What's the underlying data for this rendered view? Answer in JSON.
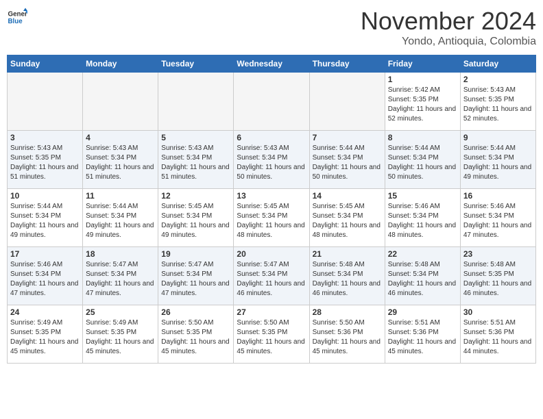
{
  "header": {
    "logo_line1": "General",
    "logo_line2": "Blue",
    "month": "November 2024",
    "location": "Yondo, Antioquia, Colombia"
  },
  "weekdays": [
    "Sunday",
    "Monday",
    "Tuesday",
    "Wednesday",
    "Thursday",
    "Friday",
    "Saturday"
  ],
  "weeks": [
    [
      {
        "day": "",
        "empty": true
      },
      {
        "day": "",
        "empty": true
      },
      {
        "day": "",
        "empty": true
      },
      {
        "day": "",
        "empty": true
      },
      {
        "day": "",
        "empty": true
      },
      {
        "day": "1",
        "sunrise": "5:42 AM",
        "sunset": "5:35 PM",
        "daylight": "11 hours and 52 minutes."
      },
      {
        "day": "2",
        "sunrise": "5:43 AM",
        "sunset": "5:35 PM",
        "daylight": "11 hours and 52 minutes."
      }
    ],
    [
      {
        "day": "3",
        "sunrise": "5:43 AM",
        "sunset": "5:35 PM",
        "daylight": "11 hours and 51 minutes."
      },
      {
        "day": "4",
        "sunrise": "5:43 AM",
        "sunset": "5:34 PM",
        "daylight": "11 hours and 51 minutes."
      },
      {
        "day": "5",
        "sunrise": "5:43 AM",
        "sunset": "5:34 PM",
        "daylight": "11 hours and 51 minutes."
      },
      {
        "day": "6",
        "sunrise": "5:43 AM",
        "sunset": "5:34 PM",
        "daylight": "11 hours and 50 minutes."
      },
      {
        "day": "7",
        "sunrise": "5:44 AM",
        "sunset": "5:34 PM",
        "daylight": "11 hours and 50 minutes."
      },
      {
        "day": "8",
        "sunrise": "5:44 AM",
        "sunset": "5:34 PM",
        "daylight": "11 hours and 50 minutes."
      },
      {
        "day": "9",
        "sunrise": "5:44 AM",
        "sunset": "5:34 PM",
        "daylight": "11 hours and 49 minutes."
      }
    ],
    [
      {
        "day": "10",
        "sunrise": "5:44 AM",
        "sunset": "5:34 PM",
        "daylight": "11 hours and 49 minutes."
      },
      {
        "day": "11",
        "sunrise": "5:44 AM",
        "sunset": "5:34 PM",
        "daylight": "11 hours and 49 minutes."
      },
      {
        "day": "12",
        "sunrise": "5:45 AM",
        "sunset": "5:34 PM",
        "daylight": "11 hours and 49 minutes."
      },
      {
        "day": "13",
        "sunrise": "5:45 AM",
        "sunset": "5:34 PM",
        "daylight": "11 hours and 48 minutes."
      },
      {
        "day": "14",
        "sunrise": "5:45 AM",
        "sunset": "5:34 PM",
        "daylight": "11 hours and 48 minutes."
      },
      {
        "day": "15",
        "sunrise": "5:46 AM",
        "sunset": "5:34 PM",
        "daylight": "11 hours and 48 minutes."
      },
      {
        "day": "16",
        "sunrise": "5:46 AM",
        "sunset": "5:34 PM",
        "daylight": "11 hours and 47 minutes."
      }
    ],
    [
      {
        "day": "17",
        "sunrise": "5:46 AM",
        "sunset": "5:34 PM",
        "daylight": "11 hours and 47 minutes."
      },
      {
        "day": "18",
        "sunrise": "5:47 AM",
        "sunset": "5:34 PM",
        "daylight": "11 hours and 47 minutes."
      },
      {
        "day": "19",
        "sunrise": "5:47 AM",
        "sunset": "5:34 PM",
        "daylight": "11 hours and 47 minutes."
      },
      {
        "day": "20",
        "sunrise": "5:47 AM",
        "sunset": "5:34 PM",
        "daylight": "11 hours and 46 minutes."
      },
      {
        "day": "21",
        "sunrise": "5:48 AM",
        "sunset": "5:34 PM",
        "daylight": "11 hours and 46 minutes."
      },
      {
        "day": "22",
        "sunrise": "5:48 AM",
        "sunset": "5:34 PM",
        "daylight": "11 hours and 46 minutes."
      },
      {
        "day": "23",
        "sunrise": "5:48 AM",
        "sunset": "5:35 PM",
        "daylight": "11 hours and 46 minutes."
      }
    ],
    [
      {
        "day": "24",
        "sunrise": "5:49 AM",
        "sunset": "5:35 PM",
        "daylight": "11 hours and 45 minutes."
      },
      {
        "day": "25",
        "sunrise": "5:49 AM",
        "sunset": "5:35 PM",
        "daylight": "11 hours and 45 minutes."
      },
      {
        "day": "26",
        "sunrise": "5:50 AM",
        "sunset": "5:35 PM",
        "daylight": "11 hours and 45 minutes."
      },
      {
        "day": "27",
        "sunrise": "5:50 AM",
        "sunset": "5:35 PM",
        "daylight": "11 hours and 45 minutes."
      },
      {
        "day": "28",
        "sunrise": "5:50 AM",
        "sunset": "5:36 PM",
        "daylight": "11 hours and 45 minutes."
      },
      {
        "day": "29",
        "sunrise": "5:51 AM",
        "sunset": "5:36 PM",
        "daylight": "11 hours and 45 minutes."
      },
      {
        "day": "30",
        "sunrise": "5:51 AM",
        "sunset": "5:36 PM",
        "daylight": "11 hours and 44 minutes."
      }
    ]
  ],
  "labels": {
    "sunrise": "Sunrise:",
    "sunset": "Sunset:",
    "daylight": "Daylight:"
  }
}
